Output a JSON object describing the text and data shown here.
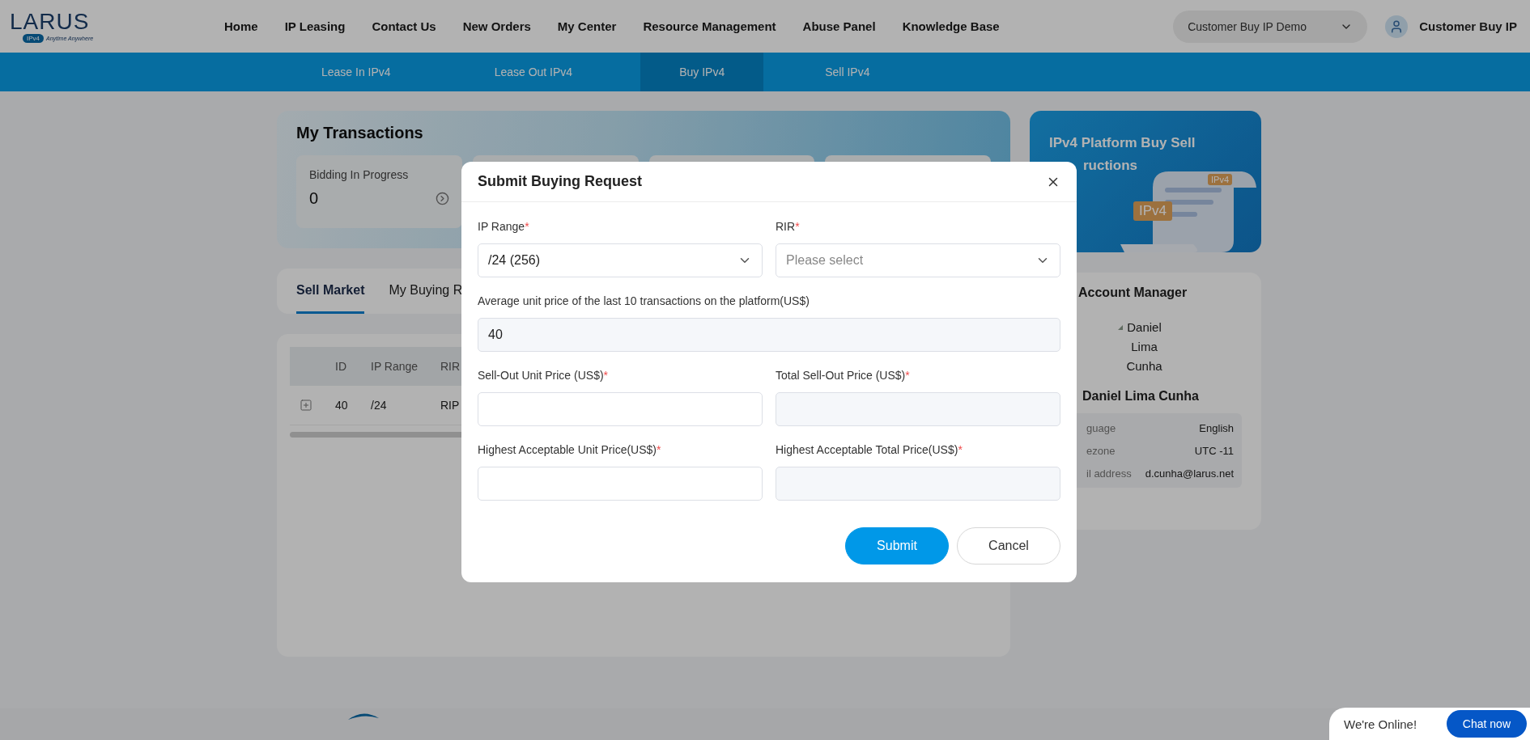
{
  "header": {
    "logo": {
      "name": "LARUS",
      "badge": "IPv4",
      "tagline": "Anytime Anywhere"
    },
    "nav": [
      "Home",
      "IP Leasing",
      "Contact Us",
      "New Orders",
      "My Center",
      "Resource Management",
      "Abuse Panel",
      "Knowledge Base"
    ],
    "account_selector": "Customer Buy IP Demo",
    "user": "Customer Buy IP"
  },
  "subnav": [
    {
      "label": "Lease In IPv4",
      "selected": false
    },
    {
      "label": "Lease Out IPv4",
      "selected": false
    },
    {
      "label": "Buy IPv4",
      "selected": true
    },
    {
      "label": "Sell IPv4",
      "selected": false
    }
  ],
  "transactions": {
    "title": "My Transactions",
    "cards": [
      {
        "kind": "stat",
        "label": "Bidding In Progress",
        "value": "0"
      },
      {
        "kind": "covered"
      },
      {
        "kind": "covered"
      },
      {
        "kind": "covered"
      }
    ]
  },
  "market_tabs": [
    {
      "label": "Sell Market",
      "selected": true
    },
    {
      "label": "My Buying R",
      "selected": false
    }
  ],
  "table": {
    "columns": [
      "ID",
      "IP Range",
      "RIR"
    ],
    "rows": [
      [
        "40",
        "/24",
        "RIP"
      ]
    ]
  },
  "instructions_banner": {
    "title": "IPv4 Platform Buy Sell",
    "title_rest": "ructions",
    "badges": [
      "IPv4",
      "IPv4"
    ]
  },
  "account_manager": {
    "title": "Account Manager",
    "avatar_alt": "Daniel Lima Cunha",
    "name": "Daniel Lima Cunha",
    "details": [
      {
        "label": "guage",
        "value": "English"
      },
      {
        "label": "ezone",
        "value": "UTC -11"
      },
      {
        "label": "il address",
        "value": "d.cunha@larus.net"
      }
    ]
  },
  "modal": {
    "title": "Submit Buying Request",
    "required_mark": "*",
    "fields": [
      {
        "kind": "select",
        "label": "IP Range",
        "required": true,
        "value": "/24 (256)"
      },
      {
        "kind": "select",
        "label": "RIR",
        "required": true,
        "placeholder": "Please select"
      },
      {
        "kind": "display",
        "label": "Average unit price of the last 10 transactions on the platform(US$)",
        "required": false,
        "value": "40"
      },
      {
        "kind": "input",
        "label": "Sell-Out Unit Price (US$)",
        "required": true
      },
      {
        "kind": "computed",
        "label": "Total Sell-Out Price (US$)",
        "required": true
      },
      {
        "kind": "input",
        "label": "Highest Acceptable Unit Price(US$)",
        "required": true
      },
      {
        "kind": "computed",
        "label": "Highest Acceptable Total Price(US$)",
        "required": true
      }
    ],
    "buttons": [
      {
        "kind": "primary",
        "label": "Submit"
      },
      {
        "kind": "secondary",
        "label": "Cancel"
      }
    ]
  },
  "chat": {
    "status": "We're Online!",
    "button": "Chat now"
  }
}
